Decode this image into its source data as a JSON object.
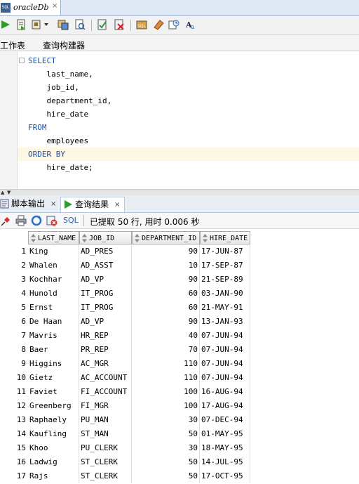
{
  "document_tab": {
    "title": "oracleDb",
    "close": "×",
    "icon_text": "SQL"
  },
  "toolbar": {
    "buttons": [
      "run-statement",
      "run-script",
      "autotrace",
      "explain-plan",
      "sql-tuning",
      "commit",
      "rollback",
      "sql-worksheet",
      "clear",
      "history",
      "find",
      "format-case"
    ]
  },
  "worksheet_tabs": [
    "工作表",
    "查询构建器"
  ],
  "editor": {
    "lines": [
      {
        "text": "SELECT",
        "keyword": true
      },
      {
        "text": "    last_name,",
        "keyword": false
      },
      {
        "text": "    job_id,",
        "keyword": false
      },
      {
        "text": "    department_id,",
        "keyword": false
      },
      {
        "text": "    hire_date",
        "keyword": false
      },
      {
        "text": "FROM",
        "keyword": true
      },
      {
        "text": "    employees",
        "keyword": false
      },
      {
        "text": "ORDER BY",
        "keyword": true
      },
      {
        "text": "    hire_date;",
        "keyword": false
      }
    ]
  },
  "output_tabs": {
    "script_output": "脚本输出",
    "query_result": "查询结果",
    "close": "×"
  },
  "result_toolbar": {
    "sql_label": "SQL",
    "status": "已提取 50 行, 用时 0.006 秒"
  },
  "grid": {
    "columns": [
      "LAST_NAME",
      "JOB_ID",
      "DEPARTMENT_ID",
      "HIRE_DATE"
    ],
    "rows": [
      [
        "1",
        "King",
        "AD_PRES",
        "90",
        "17-JUN-87"
      ],
      [
        "2",
        "Whalen",
        "AD_ASST",
        "10",
        "17-SEP-87"
      ],
      [
        "3",
        "Kochhar",
        "AD_VP",
        "90",
        "21-SEP-89"
      ],
      [
        "4",
        "Hunold",
        "IT_PROG",
        "60",
        "03-JAN-90"
      ],
      [
        "5",
        "Ernst",
        "IT_PROG",
        "60",
        "21-MAY-91"
      ],
      [
        "6",
        "De Haan",
        "AD_VP",
        "90",
        "13-JAN-93"
      ],
      [
        "7",
        "Mavris",
        "HR_REP",
        "40",
        "07-JUN-94"
      ],
      [
        "8",
        "Baer",
        "PR_REP",
        "70",
        "07-JUN-94"
      ],
      [
        "9",
        "Higgins",
        "AC_MGR",
        "110",
        "07-JUN-94"
      ],
      [
        "10",
        "Gietz",
        "AC_ACCOUNT",
        "110",
        "07-JUN-94"
      ],
      [
        "11",
        "Faviet",
        "FI_ACCOUNT",
        "100",
        "16-AUG-94"
      ],
      [
        "12",
        "Greenberg",
        "FI_MGR",
        "100",
        "17-AUG-94"
      ],
      [
        "13",
        "Raphaely",
        "PU_MAN",
        "30",
        "07-DEC-94"
      ],
      [
        "14",
        "Kaufling",
        "ST_MAN",
        "50",
        "01-MAY-95"
      ],
      [
        "15",
        "Khoo",
        "PU_CLERK",
        "30",
        "18-MAY-95"
      ],
      [
        "16",
        "Ladwig",
        "ST_CLERK",
        "50",
        "14-JUL-95"
      ],
      [
        "17",
        "Rajs",
        "ST_CLERK",
        "50",
        "17-OCT-95"
      ]
    ]
  }
}
